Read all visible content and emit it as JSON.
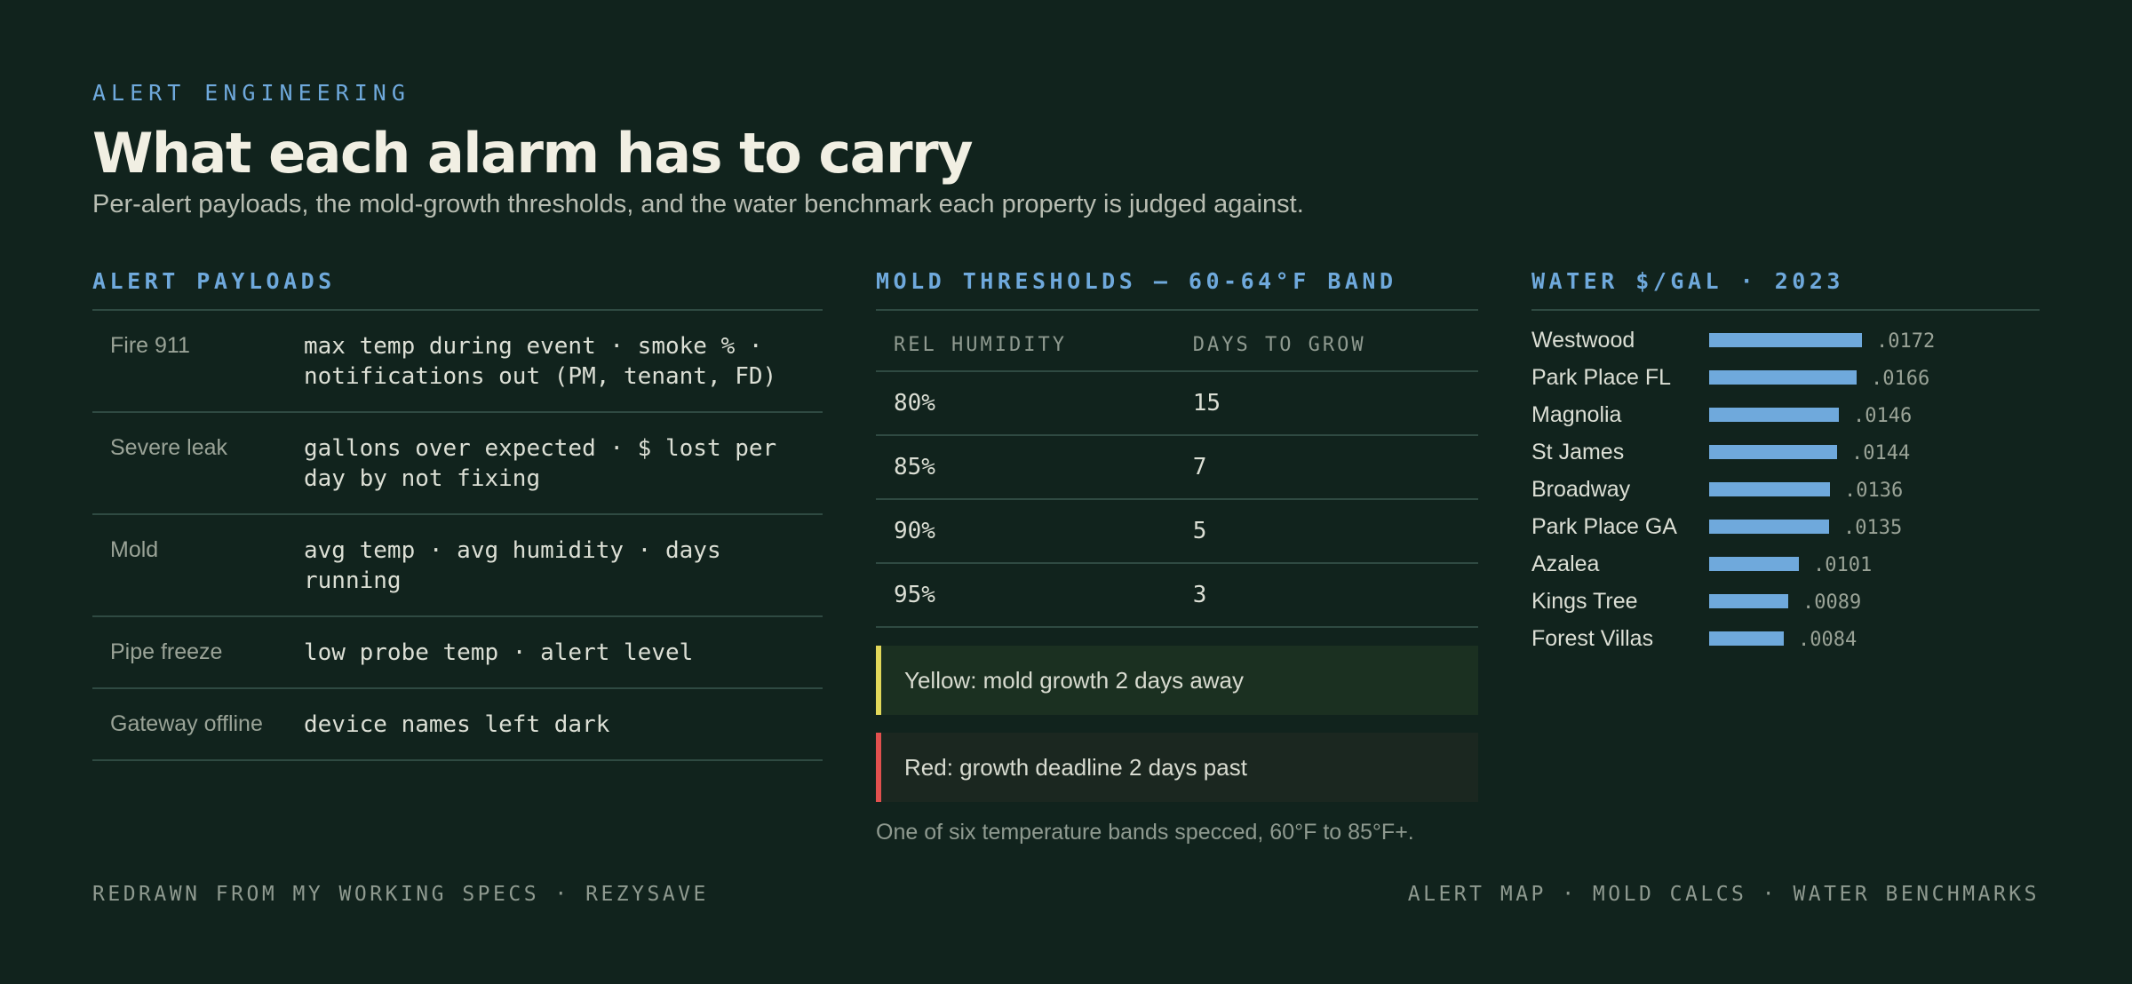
{
  "header": {
    "eyebrow": "ALERT ENGINEERING",
    "title": "What each alarm has to carry",
    "subtitle": "Per-alert payloads, the mold-growth thresholds, and the water benchmark each property is judged against."
  },
  "payloads": {
    "heading": "ALERT PAYLOADS",
    "rows": [
      {
        "name": "Fire 911",
        "desc": "max temp during event · smoke % · notifications out (PM, tenant, FD)"
      },
      {
        "name": "Severe leak",
        "desc": "gallons over expected · $ lost per day by not fixing"
      },
      {
        "name": "Mold",
        "desc": "avg temp · avg humidity · days running"
      },
      {
        "name": "Pipe freeze",
        "desc": "low probe temp · alert level"
      },
      {
        "name": "Gateway offline",
        "desc": "device names left dark"
      }
    ]
  },
  "mold": {
    "heading": "MOLD THRESHOLDS — 60-64°F BAND",
    "columns": [
      "REL HUMIDITY",
      "DAYS TO GROW"
    ],
    "rows": [
      {
        "humidity": "80%",
        "days": "15"
      },
      {
        "humidity": "85%",
        "days": "7"
      },
      {
        "humidity": "90%",
        "days": "5"
      },
      {
        "humidity": "95%",
        "days": "3"
      }
    ],
    "callout_yellow": "Yellow: mold growth 2 days away",
    "callout_red": "Red: growth deadline 2 days past",
    "footnote": "One of six temperature bands specced, 60°F to 85°F+.",
    "colors": {
      "yellow": "#e2d85a",
      "red": "#e2504e"
    }
  },
  "water": {
    "heading": "WATER $/GAL · 2023"
  },
  "chart_data": {
    "type": "bar",
    "orientation": "horizontal",
    "title": "WATER $/GAL · 2023",
    "categories": [
      "Westwood",
      "Park Place FL",
      "Magnolia",
      "St James",
      "Broadway",
      "Park Place GA",
      "Azalea",
      "Kings Tree",
      "Forest Villas"
    ],
    "values": [
      0.0172,
      0.0166,
      0.0146,
      0.0144,
      0.0136,
      0.0135,
      0.0101,
      0.0089,
      0.0084
    ],
    "value_labels": [
      ".0172",
      ".0166",
      ".0146",
      ".0144",
      ".0136",
      ".0135",
      ".0101",
      ".0089",
      ".0084"
    ],
    "xlim": [
      0,
      0.0172
    ],
    "grid": false,
    "bar_color": "#6fa9dc"
  },
  "footer": {
    "left": "REDRAWN FROM MY WORKING SPECS · REZYSAVE",
    "right": "ALERT MAP · MOLD CALCS · WATER BENCHMARKS"
  }
}
